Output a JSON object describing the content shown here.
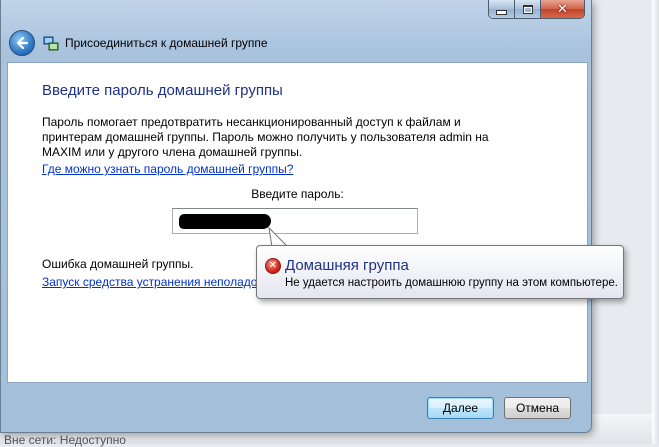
{
  "window": {
    "title": "Присоединиться к домашней группе",
    "caption": {
      "minimize": "",
      "maximize": "",
      "close": "✕"
    }
  },
  "content": {
    "heading": "Введите пароль домашней группы",
    "description": "Пароль помогает предотвратить несанкционированный доступ к файлам и принтерам домашней группы. Пароль можно получить у пользователя admin на MAXIM или у другого члена домашней группы.",
    "where_link": "Где можно узнать пароль домашней группы?",
    "password_label": "Введите пароль:",
    "password_value": "",
    "error_label": "Ошибка домашней группы.",
    "troubleshoot_link": "Запуск средства устранения неполадок домашней группы"
  },
  "balloon": {
    "title": "Домашняя группа",
    "message": "Не удается настроить домашнюю группу на этом компьютере."
  },
  "buttons": {
    "next": "Далее",
    "cancel": "Отмена"
  },
  "desktop": {
    "status_text": "Вне сети: Недоступно"
  },
  "icons": {
    "back": "back-arrow-icon",
    "homegroup": "homegroup-icon",
    "error": "error-icon"
  }
}
